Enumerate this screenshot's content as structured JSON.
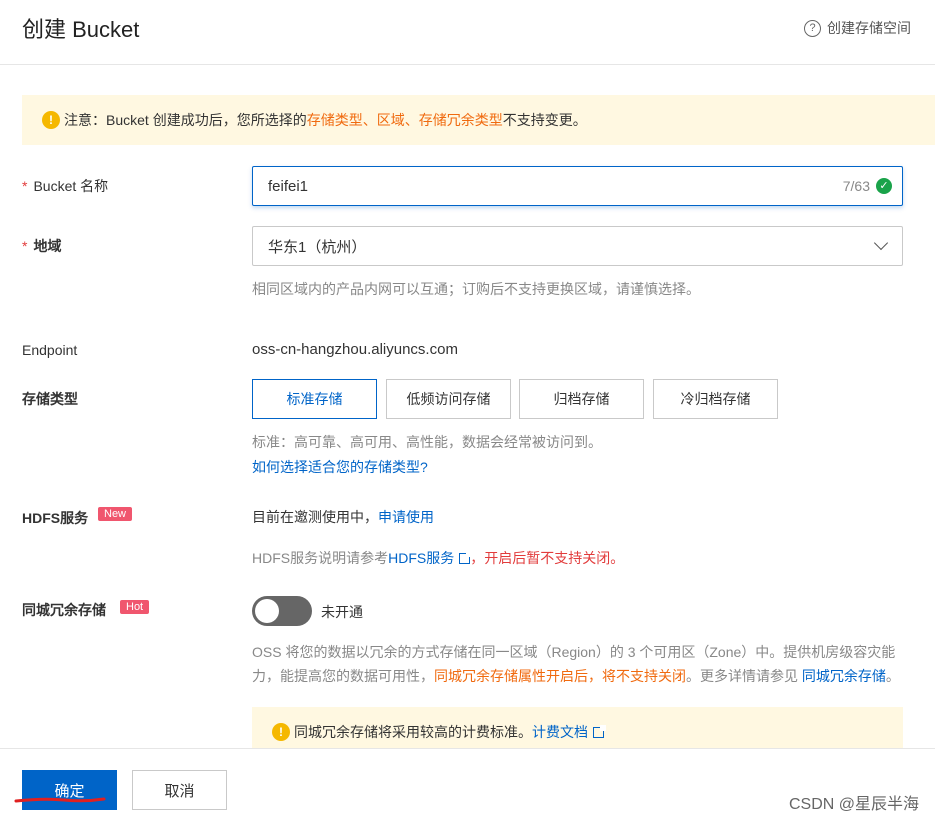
{
  "header": {
    "title": "创建 Bucket",
    "help_label": "创建存储空间",
    "help_icon": "question-circle-icon"
  },
  "notice": {
    "prefix": "注意：Bucket 创建成功后，您所选择的 ",
    "storage_type": "存储类型",
    "sep1": "、",
    "region": "区域",
    "sep2": "、",
    "redundancy": "存储冗余类型",
    "suffix": " 不支持变更。"
  },
  "bucket_name": {
    "label": "Bucket 名称",
    "required": "*",
    "value": "feifei1",
    "counter": "7/63"
  },
  "region": {
    "label": "地域",
    "required": "*",
    "value": "华东1（杭州）",
    "hint": "相同区域内的产品内网可以互通；订购后不支持更换区域，请谨慎选择。"
  },
  "endpoint": {
    "label": "Endpoint",
    "value": "oss-cn-hangzhou.aliyuncs.com"
  },
  "storage_type": {
    "label": "存储类型",
    "options": [
      "标准存储",
      "低频访问存储",
      "归档存储",
      "冷归档存储"
    ],
    "selected": "标准存储",
    "hint": "标准：高可靠、高可用、高性能，数据会经常被访问到。",
    "link": "如何选择适合您的存储类型?"
  },
  "hdfs": {
    "label": "HDFS服务",
    "badge": "New",
    "status": "目前在邀测使用中，",
    "apply_link": "申请使用",
    "note_prefix": "HDFS服务说明请参考",
    "note_link": "HDFS服务",
    "note_warn": "，开启后暂不支持关闭。"
  },
  "zone_redundancy": {
    "label": "同城冗余存储",
    "badge": "Hot",
    "toggle_label": "未开通",
    "enabled": false,
    "desc_part1": "OSS 将您的数据以冗余的方式存储在同一区域（Region）的 3 个可用区（Zone）中。提供机房级容灾能力，能提高您的数据可用性，",
    "desc_warn": "同城冗余存储属性开启后，将不支持关闭",
    "desc_part2": "。更多详情请参见 ",
    "desc_link": "同城冗余存储",
    "desc_end": "。",
    "billing_text": "同城冗余存储将采用较高的计费标准。",
    "billing_link": "计费文档"
  },
  "footer": {
    "confirm": "确定",
    "cancel": "取消"
  },
  "watermark": "CSDN @星辰半海",
  "colors": {
    "primary": "#0064c8",
    "warning": "#f06a0f",
    "notice_bg": "#fff8e1",
    "badge": "#f0566e"
  }
}
